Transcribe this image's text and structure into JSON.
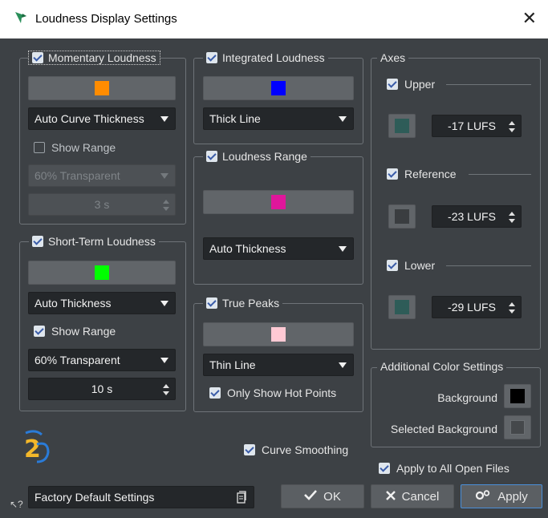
{
  "window": {
    "title": "Loudness Display Settings"
  },
  "momentary": {
    "label": "Momentary Loudness",
    "checked": true,
    "color": "#ff8c00",
    "thickness": "Auto Curve Thickness",
    "show_range": "Show Range",
    "show_range_checked": false,
    "transparency": "60% Transparent",
    "duration": "3 s"
  },
  "short_term": {
    "label": "Short-Term Loudness",
    "checked": true,
    "color": "#00ff00",
    "thickness": "Auto Thickness",
    "show_range": "Show Range",
    "show_range_checked": true,
    "transparency": "60% Transparent",
    "duration": "10 s"
  },
  "integrated": {
    "label": "Integrated Loudness",
    "checked": true,
    "color": "#0000ff",
    "thickness": "Thick Line"
  },
  "loudness_range": {
    "label": "Loudness Range",
    "checked": true,
    "color": "#e0169b",
    "thickness": "Auto Thickness"
  },
  "true_peaks": {
    "label": "True Peaks",
    "checked": true,
    "color": "#ffc9d4",
    "thickness": "Thin Line",
    "hot_points": "Only Show Hot Points",
    "hot_points_checked": true
  },
  "axes": {
    "title": "Axes",
    "upper": {
      "label": "Upper",
      "color": "#2e5c58",
      "value": "-17 LUFS"
    },
    "reference": {
      "label": "Reference",
      "color": "#3a3d40",
      "value": "-23 LUFS"
    },
    "lower": {
      "label": "Lower",
      "color": "#2e5c58",
      "value": "-29 LUFS"
    }
  },
  "additional_colors": {
    "title": "Additional Color Settings",
    "background": {
      "label": "Background",
      "color": "#000000"
    },
    "selected_background": {
      "label": "Selected Background",
      "color": "#45484b"
    }
  },
  "curve_smoothing": {
    "label": "Curve Smoothing",
    "checked": true
  },
  "apply_all": {
    "label": "Apply to All Open Files",
    "checked": true
  },
  "presets": {
    "value": "Factory Default Settings"
  },
  "buttons": {
    "ok": "OK",
    "cancel": "Cancel",
    "apply": "Apply"
  }
}
